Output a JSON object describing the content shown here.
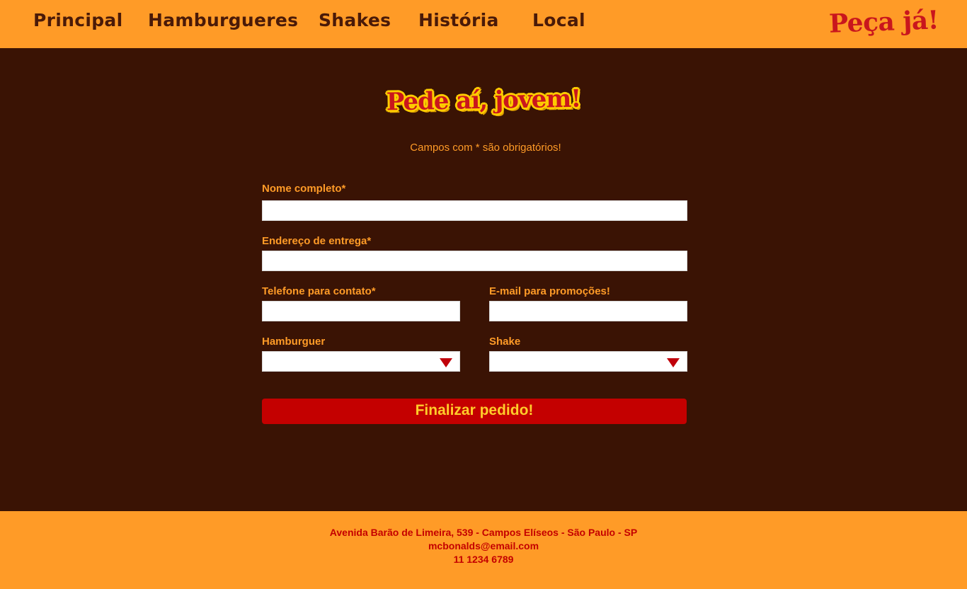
{
  "nav": {
    "items": [
      "Principal",
      "Hamburgueres",
      "Shakes",
      "História",
      "Local"
    ],
    "cta": "Peça já!"
  },
  "form": {
    "logo_text": "Pede aí, jovem!",
    "required_note": "Campos com * são obrigatórios!",
    "fields": {
      "name": {
        "label": "Nome completo*",
        "value": ""
      },
      "address": {
        "label": "Endereço de entrega*",
        "value": ""
      },
      "phone": {
        "label": "Telefone para contato*",
        "value": ""
      },
      "email": {
        "label": "E-mail para promoções!",
        "value": ""
      },
      "burger": {
        "label": "Hamburguer",
        "selected": ""
      },
      "shake": {
        "label": "Shake",
        "selected": ""
      }
    },
    "submit_label": "Finalizar pedido!"
  },
  "footer": {
    "address": "Avenida Barão de Limeira, 539 - Campos Elíseos - São Paulo - SP",
    "email": "mcbonalds@email.com",
    "phone": "11 1234 6789"
  },
  "colors": {
    "header_bg": "#ff9b27",
    "main_bg": "#3a1304",
    "accent_red": "#c40000",
    "accent_yellow": "#ffcc2a"
  },
  "icons": {
    "select_arrow": "triangle-down-icon"
  }
}
